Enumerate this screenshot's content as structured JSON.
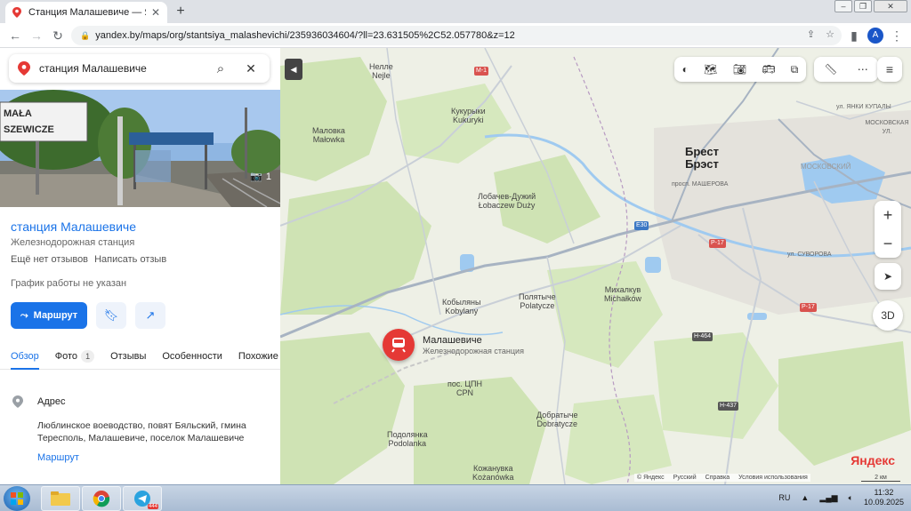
{
  "browser": {
    "tab_title": "Станция Малашевиче — Яндекс",
    "url": "yandex.by/maps/org/stantsiya_malashevichi/235936034604/?ll=23.631505%2C52.057780&z=12",
    "profile_initial": "A"
  },
  "search": {
    "value": "станция Малашевиче"
  },
  "photo": {
    "sign_text": "MAŁASZEWICZE",
    "count": "1"
  },
  "place": {
    "name": "станция Малашевиче",
    "category": "Железнодорожная станция",
    "no_reviews": "Ещё нет отзывов",
    "write_review": "Написать отзыв",
    "hours": "График работы не указан",
    "route_label": "Маршрут"
  },
  "tabs": [
    {
      "label": "Обзор"
    },
    {
      "label": "Фото",
      "badge": "1"
    },
    {
      "label": "Отзывы"
    },
    {
      "label": "Особенности"
    },
    {
      "label": "Похожие м"
    }
  ],
  "address": {
    "label": "Адрес",
    "text": "Люблинское воеводство, повят Бяльский, гмина Тересполь, Малашевиче, поселок Малашевиче",
    "route_link": "Маршрут"
  },
  "map": {
    "labels": {
      "nelle": "Нелле",
      "nelle_pl": "Nejle",
      "kukuryki": "Кукурыки",
      "kukuryki_pl": "Kukuryki",
      "malovka": "Маловка",
      "malovka_pl": "Małowka",
      "brest": "Брест",
      "brest_by": "Брэст",
      "lobachev": "Лобачев-Дужий",
      "lobachev_pl": "Łobaczew Duży",
      "kobylyany": "Кобыляны",
      "kobylyany_pl": "Kobylany",
      "polyatyche": "Полятыче",
      "polyatyche_pl": "Polatycze",
      "mikhalkuv": "Михалкув",
      "mikhalkuv_pl": "Michałków",
      "pos_cpn": "пос. ЦПН",
      "pos_cpn_pl": "CPN",
      "dobratyche": "Добратыче",
      "dobratyche_pl": "Dobratycze",
      "podolyanka": "Подолянка",
      "podolyanka_pl": "Podolanka",
      "kozhanuvka": "Кожанувка",
      "kozhanuvka_pl": "Kożanówka",
      "moskovsky": "МОСКОВСКИЙ",
      "street_masherova": "просп. МАШЕРОВА",
      "street_mosk": "МОСКОВСКАЯ УЛ.",
      "street_yanki": "ул. ЯНКИ КУПАЛЫ",
      "street_suvorova": "ул. СУВОРОВА"
    },
    "road_labels": [
      "M-1",
      "E30",
      "P-17",
      "P-17",
      "H-464",
      "H-437"
    ],
    "marker_name": "Малашевиче",
    "marker_category": "Железнодорожная станция",
    "logo": "Яндекс",
    "footer": [
      "© Яндекс",
      "Русский",
      "Справка",
      "Условия использования"
    ],
    "scale": "2 км",
    "btn_3d": "3D"
  },
  "taskbar": {
    "lang": "RU",
    "time": "11:32",
    "date": "10.09.2025",
    "telegram_badge": "444"
  },
  "colors": {
    "accent": "#1a73e8",
    "marker": "#e53935",
    "forest": "#cfe3b4",
    "water": "#9fcaf0"
  }
}
